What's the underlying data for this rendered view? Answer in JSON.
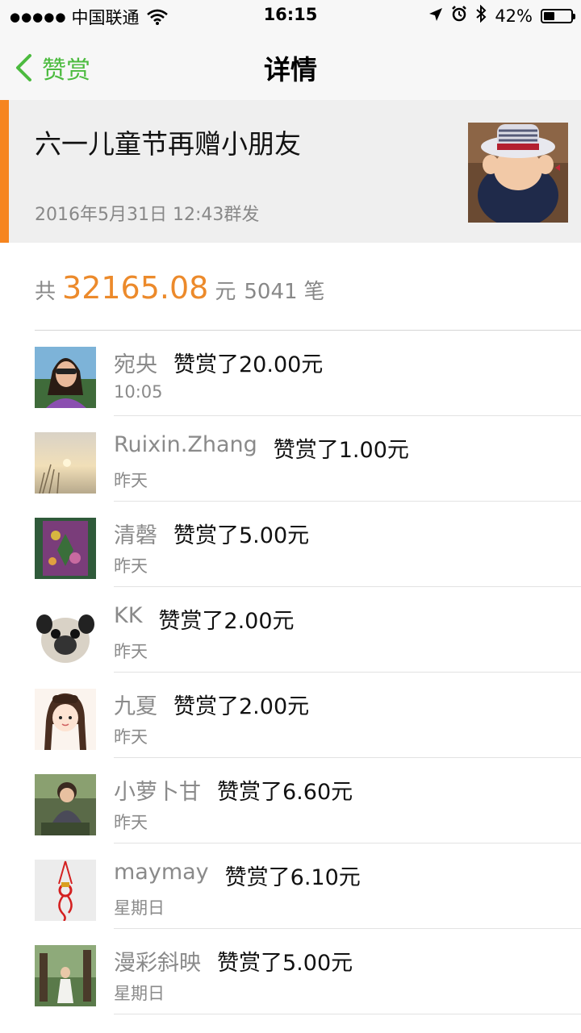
{
  "status_bar": {
    "signal_dots": "●●●●●",
    "carrier": "中国联通",
    "time": "16:15",
    "battery": "42%",
    "battery_level": 0.42,
    "icons": [
      "wifi-icon",
      "location-arrow-icon",
      "alarm-icon",
      "bluetooth-icon",
      "battery-icon"
    ]
  },
  "nav": {
    "back_label": "赞赏",
    "title": "详情",
    "accent_color": "#4cbb3f"
  },
  "article": {
    "title": "六一儿童节再赠小朋友",
    "date": "2016年5月31日 12:43群发",
    "accent_color": "#f6851f"
  },
  "summary": {
    "prefix": "共",
    "amount": "32165.08",
    "unit": "元",
    "count": "5041",
    "count_unit": "笔",
    "amount_color": "#ec8a2b"
  },
  "rewards": [
    {
      "name": "宛央",
      "action": "赞赏了20.00元",
      "time": "10:05"
    },
    {
      "name": "Ruixin.Zhang",
      "action": "赞赏了1.00元",
      "time": "昨天"
    },
    {
      "name": "清磬",
      "action": "赞赏了5.00元",
      "time": "昨天"
    },
    {
      "name": "KK",
      "action": "赞赏了2.00元",
      "time": "昨天"
    },
    {
      "name": "九夏",
      "action": "赞赏了2.00元",
      "time": "昨天"
    },
    {
      "name": "小萝卜甘",
      "action": "赞赏了6.60元",
      "time": "昨天"
    },
    {
      "name": "maymay",
      "action": "赞赏了6.10元",
      "time": "星期日"
    },
    {
      "name": "漫彩斜映",
      "action": "赞赏了5.00元",
      "time": "星期日"
    }
  ]
}
